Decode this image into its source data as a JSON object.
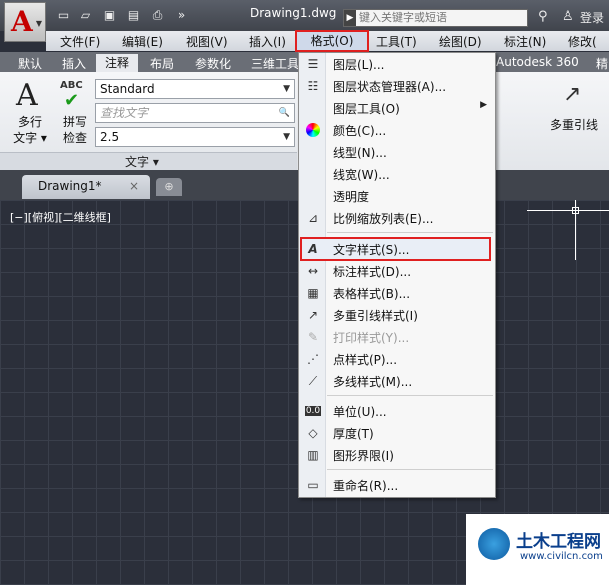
{
  "titlebar": {
    "doc_title": "Drawing1.dwg",
    "search_placeholder": "键入关键字或短语",
    "login": "登录",
    "quick_access_icons": [
      "new-icon",
      "open-icon",
      "save-icon",
      "save-as-icon",
      "print-icon",
      "more-icon"
    ]
  },
  "menubar": {
    "items": [
      "文件(F)",
      "编辑(E)",
      "视图(V)",
      "插入(I)",
      "格式(O)",
      "工具(T)",
      "绘图(D)",
      "标注(N)",
      "修改("
    ]
  },
  "ribbon_tabs": {
    "items": [
      "默认",
      "插入",
      "注释",
      "布局",
      "参数化",
      "三维工具",
      "Autodesk 360",
      "精"
    ],
    "active": "注释"
  },
  "ribbon": {
    "multiline_text": "多行\n文字",
    "spell_check": "拼写\n检查",
    "abc": "ABC",
    "style_value": "Standard",
    "find_placeholder": "查找文字",
    "height_value": "2.5",
    "panel_label": "文字 ▾",
    "right_label": "多重引线"
  },
  "doc_tab": {
    "label": "Drawing1*",
    "close": "×"
  },
  "viewport": {
    "label": "[−][俯视][二维线框]"
  },
  "format_menu": {
    "items": [
      {
        "label": "图层(L)...",
        "icon": "layer-icon"
      },
      {
        "label": "图层状态管理器(A)...",
        "icon": "layer-state-icon"
      },
      {
        "label": "图层工具(O)",
        "icon": "",
        "submenu": "▶"
      },
      {
        "label": "颜色(C)...",
        "icon": "color-wheel-icon"
      },
      {
        "label": "线型(N)...",
        "icon": ""
      },
      {
        "label": "线宽(W)...",
        "icon": ""
      },
      {
        "label": "透明度",
        "icon": ""
      },
      {
        "label": "比例缩放列表(E)...",
        "icon": "scale-list-icon"
      },
      {
        "label": "文字样式(S)...",
        "icon": "text-style-icon"
      },
      {
        "label": "标注样式(D)...",
        "icon": "dim-style-icon"
      },
      {
        "label": "表格样式(B)...",
        "icon": "table-style-icon"
      },
      {
        "label": "多重引线样式(I)",
        "icon": "mleader-style-icon"
      },
      {
        "label": "打印样式(Y)...",
        "icon": "plot-style-icon",
        "disabled": true
      },
      {
        "label": "点样式(P)...",
        "icon": "point-style-icon"
      },
      {
        "label": "多线样式(M)...",
        "icon": "mline-style-icon"
      },
      {
        "label": "单位(U)...",
        "icon": "units-icon"
      },
      {
        "label": "厚度(T)",
        "icon": "thickness-icon"
      },
      {
        "label": "图形界限(I)",
        "icon": "limits-icon"
      },
      {
        "label": "重命名(R)...",
        "icon": "rename-icon"
      }
    ]
  },
  "watermark": {
    "title": "土木工程网",
    "url": "www.civilcn.com"
  }
}
